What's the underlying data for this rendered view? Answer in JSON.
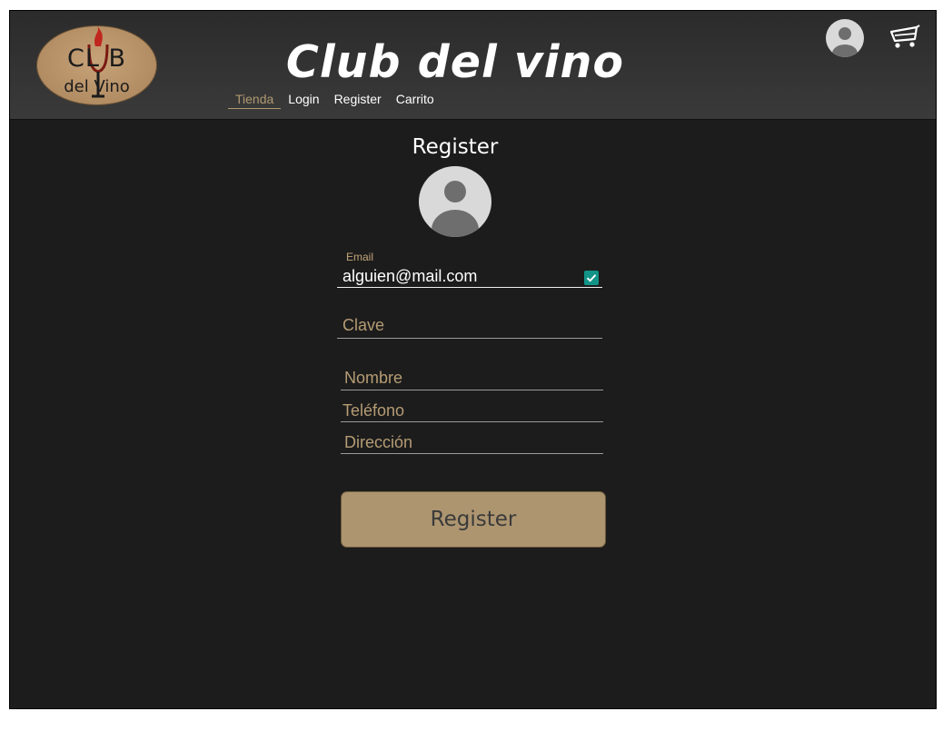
{
  "logo": {
    "top_text": "CL B",
    "bottom_text": "del Vino"
  },
  "header": {
    "title": "Club del vino",
    "nav": [
      {
        "label": "Tienda",
        "active": true
      },
      {
        "label": "Login",
        "active": false
      },
      {
        "label": "Register",
        "active": false
      },
      {
        "label": "Carrito",
        "active": false
      }
    ],
    "icons": {
      "avatar": "user-avatar-icon",
      "cart": "shopping-cart-icon"
    }
  },
  "form": {
    "title": "Register",
    "email": {
      "label": "Email",
      "value": "alguien@mail.com",
      "checked": true
    },
    "password": {
      "placeholder": "Clave"
    },
    "name": {
      "placeholder": "Nombre"
    },
    "phone": {
      "placeholder": "Teléfono"
    },
    "address": {
      "placeholder": "Dirección"
    },
    "submit_label": "Register"
  },
  "colors": {
    "background": "#1c1c1c",
    "header": "#333333",
    "accent": "#ad9570",
    "checkbox": "#129488"
  }
}
